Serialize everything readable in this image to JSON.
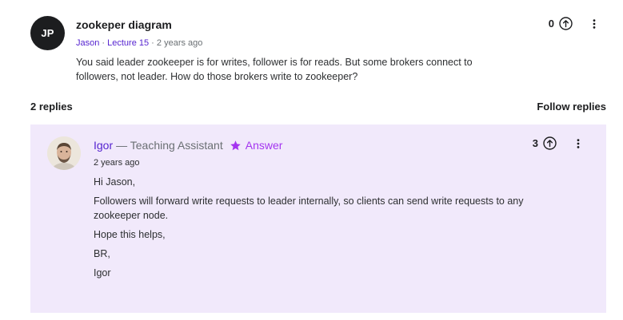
{
  "question": {
    "avatar_initials": "JP",
    "title": "zookeper diagram",
    "author": "Jason",
    "separator_1": " · ",
    "lecture": "Lecture 15",
    "separator_2": " · ",
    "time": "2 years ago",
    "body": "You said leader zookeeper is for writes, follower is for reads. But some brokers connect to followers, not leader. How do those brokers write to zookeeper?",
    "votes": "0",
    "upvote_icon": "arrow-up-circle-icon",
    "more_icon": "vertical-ellipsis-icon"
  },
  "replies_header": {
    "count_label": "2 replies",
    "follow_label": "Follow replies"
  },
  "reply": {
    "author": "Igor",
    "role": "— Teaching Assistant",
    "badge_icon": "star-icon",
    "badge_label": "Answer",
    "time": "2 years ago",
    "paragraphs": [
      "Hi Jason,",
      "Followers will forward write requests to leader internally, so clients can send write requests to any zookeeper node.",
      "Hope this helps,",
      "BR,",
      "Igor"
    ],
    "votes": "3",
    "upvote_icon": "arrow-up-circle-icon",
    "more_icon": "vertical-ellipsis-icon"
  },
  "colors": {
    "accent_purple": "#5624d0",
    "badge_purple": "#a435f0",
    "reply_background": "#f1e9fb",
    "avatar_dark": "#1c1d1f"
  }
}
